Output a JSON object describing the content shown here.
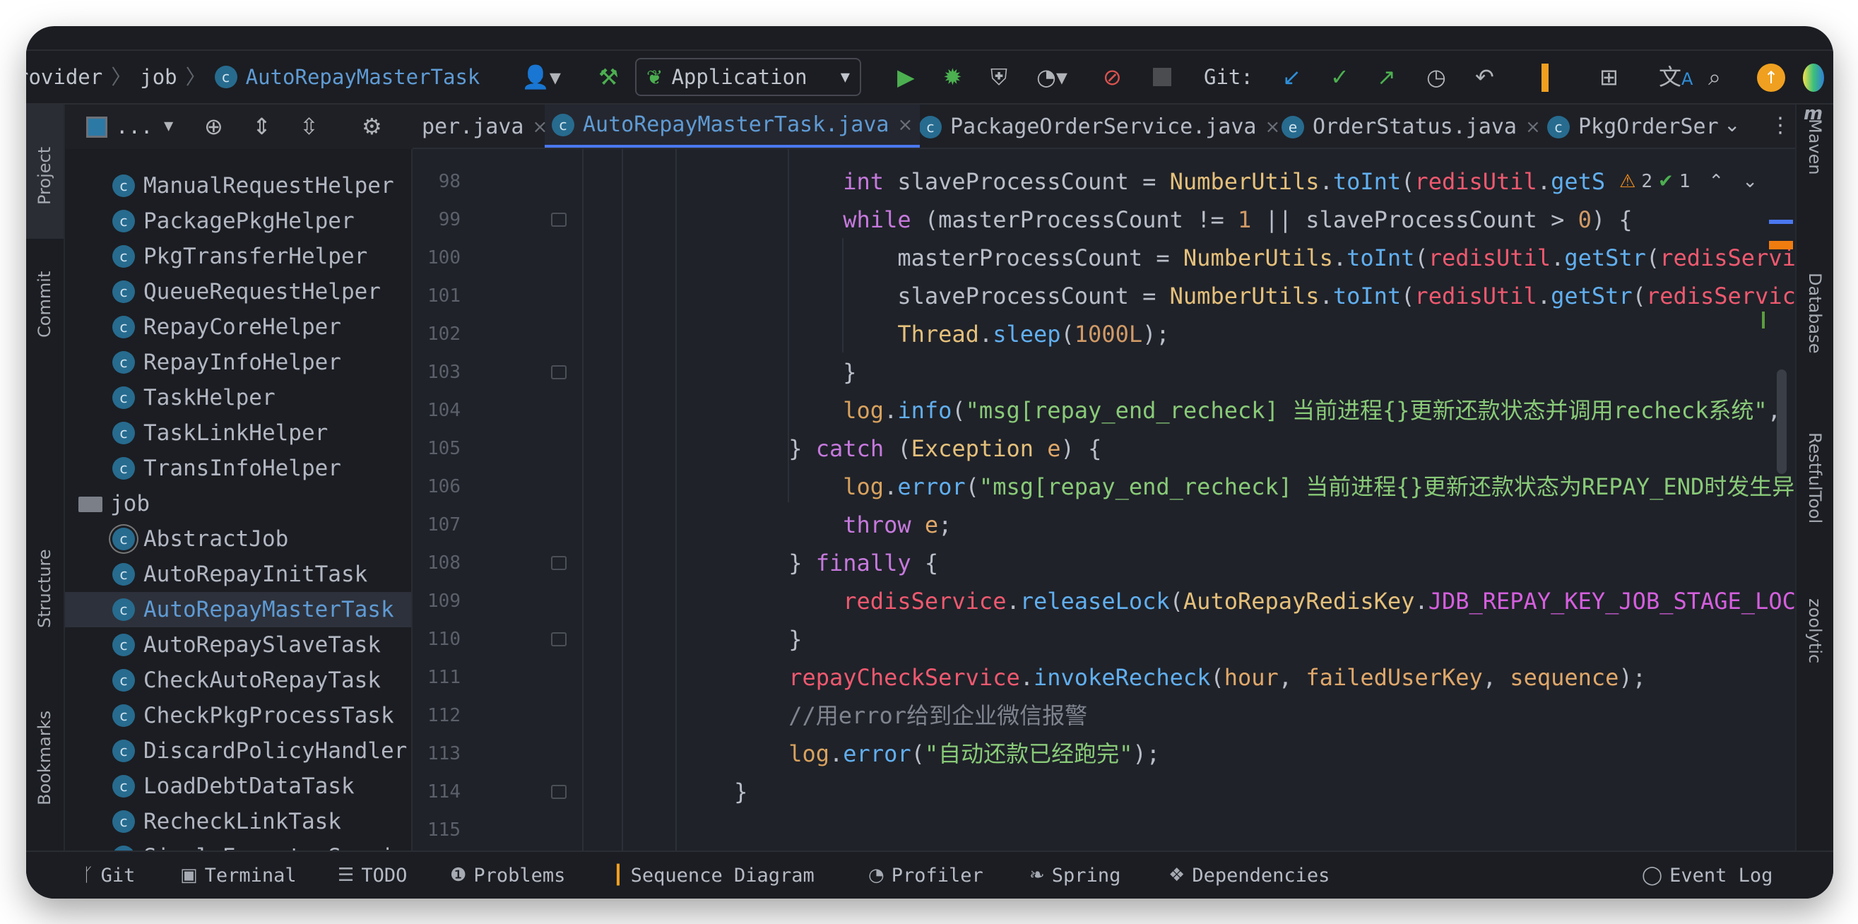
{
  "toolbar": {
    "breadcrumb": [
      "rovider",
      "job",
      "AutoRepayMasterTask"
    ],
    "run_config": "Application",
    "git_label": "Git:"
  },
  "left_strip": [
    "Project",
    "Commit",
    "Structure",
    "Bookmarks"
  ],
  "right_strip": [
    "Maven",
    "Database",
    "RestfulTool",
    "zoolytic"
  ],
  "project_panel": {
    "view_label": "...",
    "tree": [
      {
        "label": "ManualRequestHelper",
        "type": "class"
      },
      {
        "label": "PackagePkgHelper",
        "type": "class"
      },
      {
        "label": "PkgTransferHelper",
        "type": "class"
      },
      {
        "label": "QueueRequestHelper",
        "type": "class"
      },
      {
        "label": "RepayCoreHelper",
        "type": "class"
      },
      {
        "label": "RepayInfoHelper",
        "type": "class"
      },
      {
        "label": "TaskHelper",
        "type": "class"
      },
      {
        "label": "TaskLinkHelper",
        "type": "class"
      },
      {
        "label": "TransInfoHelper",
        "type": "class"
      },
      {
        "label": "job",
        "type": "folder"
      },
      {
        "label": "AbstractJob",
        "type": "abstract"
      },
      {
        "label": "AutoRepayInitTask",
        "type": "class"
      },
      {
        "label": "AutoRepayMasterTask",
        "type": "class",
        "selected": true
      },
      {
        "label": "AutoRepaySlaveTask",
        "type": "class"
      },
      {
        "label": "CheckAutoRepayTask",
        "type": "class"
      },
      {
        "label": "CheckPkgProcessTask",
        "type": "class"
      },
      {
        "label": "DiscardPolicyHandler",
        "type": "class"
      },
      {
        "label": "LoadDebtDataTask",
        "type": "class"
      },
      {
        "label": "RecheckLinkTask",
        "type": "class"
      },
      {
        "label": "SimpleExecutorService",
        "type": "class"
      }
    ]
  },
  "tabs": [
    {
      "label": "per.java",
      "icon": ""
    },
    {
      "label": "AutoRepayMasterTask.java",
      "icon": "C",
      "active": true
    },
    {
      "label": "PackageOrderService.java",
      "icon": "C"
    },
    {
      "label": "OrderStatus.java",
      "icon": "E"
    },
    {
      "label": "PkgOrderSer",
      "icon": "C"
    }
  ],
  "inspections": {
    "warnings": "2",
    "ok": "1"
  },
  "code": [
    {
      "n": "98",
      "indent": 20,
      "t": [
        [
          "int",
          "kw"
        ],
        [
          " slaveProcessCount = ",
          "df"
        ],
        [
          "NumberUtils",
          "cls"
        ],
        [
          ".",
          "df"
        ],
        [
          "toInt",
          "fn"
        ],
        [
          "(",
          "df"
        ],
        [
          "redisUtil",
          "fld"
        ],
        [
          ".",
          "df"
        ],
        [
          "getS",
          "fn"
        ]
      ]
    },
    {
      "n": "99",
      "indent": 20,
      "t": [
        [
          "while",
          "kw"
        ],
        [
          " (masterProcessCount != ",
          "df"
        ],
        [
          "1",
          "num"
        ],
        [
          " || slaveProcessCount > ",
          "df"
        ],
        [
          "0",
          "num"
        ],
        [
          ") {",
          "df"
        ]
      ]
    },
    {
      "n": "100",
      "indent": 24,
      "t": [
        [
          "masterProcessCount = ",
          "df"
        ],
        [
          "NumberUtils",
          "cls"
        ],
        [
          ".",
          "df"
        ],
        [
          "toInt",
          "fn"
        ],
        [
          "(",
          "df"
        ],
        [
          "redisUtil",
          "fld"
        ],
        [
          ".",
          "df"
        ],
        [
          "getStr",
          "fn"
        ],
        [
          "(",
          "df"
        ],
        [
          "redisService",
          "fld"
        ]
      ]
    },
    {
      "n": "101",
      "indent": 24,
      "t": [
        [
          "slaveProcessCount = ",
          "df"
        ],
        [
          "NumberUtils",
          "cls"
        ],
        [
          ".",
          "df"
        ],
        [
          "toInt",
          "fn"
        ],
        [
          "(",
          "df"
        ],
        [
          "redisUtil",
          "fld"
        ],
        [
          ".",
          "df"
        ],
        [
          "getStr",
          "fn"
        ],
        [
          "(",
          "df"
        ],
        [
          "redisService",
          "fld"
        ]
      ]
    },
    {
      "n": "102",
      "indent": 24,
      "t": [
        [
          "Thread",
          "cls"
        ],
        [
          ".",
          "df"
        ],
        [
          "sleep",
          "fn"
        ],
        [
          "(",
          "df"
        ],
        [
          "1000L",
          "num"
        ],
        [
          ");",
          "df"
        ]
      ]
    },
    {
      "n": "103",
      "indent": 20,
      "t": [
        [
          "}",
          "df"
        ]
      ]
    },
    {
      "n": "104",
      "indent": 20,
      "t": [
        [
          "log",
          "lg"
        ],
        [
          ".",
          "df"
        ],
        [
          "info",
          "fn"
        ],
        [
          "(",
          "df"
        ],
        [
          "\"msg[repay_end_recheck] 当前进程{}更新还款状态并调用recheck系统\"",
          "str"
        ],
        [
          ", ",
          "df"
        ]
      ]
    },
    {
      "n": "105",
      "indent": 16,
      "t": [
        [
          "} ",
          "df"
        ],
        [
          "catch",
          "kw"
        ],
        [
          " (",
          "df"
        ],
        [
          "Exception",
          "cls"
        ],
        [
          " ",
          "df"
        ],
        [
          "e",
          "loc"
        ],
        [
          ") {",
          "df"
        ]
      ]
    },
    {
      "n": "106",
      "indent": 20,
      "t": [
        [
          "log",
          "lg"
        ],
        [
          ".",
          "df"
        ],
        [
          "error",
          "fn"
        ],
        [
          "(",
          "df"
        ],
        [
          "\"msg[repay_end_recheck] 当前进程{}更新还款状态为REPAY_END时发生异常\"",
          "str"
        ]
      ]
    },
    {
      "n": "107",
      "indent": 20,
      "t": [
        [
          "throw",
          "kw"
        ],
        [
          " ",
          "df"
        ],
        [
          "e",
          "loc"
        ],
        [
          ";",
          "df"
        ]
      ]
    },
    {
      "n": "108",
      "indent": 16,
      "t": [
        [
          "} ",
          "df"
        ],
        [
          "finally",
          "kw"
        ],
        [
          " {",
          "df"
        ]
      ]
    },
    {
      "n": "109",
      "indent": 20,
      "t": [
        [
          "redisService",
          "fld"
        ],
        [
          ".",
          "df"
        ],
        [
          "releaseLock",
          "fn"
        ],
        [
          "(",
          "df"
        ],
        [
          "AutoRepayRedisKey",
          "cls"
        ],
        [
          ".",
          "df"
        ],
        [
          "JDB_REPAY_KEY_JOB_STAGE_LOCK",
          "cst"
        ]
      ]
    },
    {
      "n": "110",
      "indent": 16,
      "t": [
        [
          "}",
          "df"
        ]
      ]
    },
    {
      "n": "111",
      "indent": 16,
      "t": [
        [
          "repayCheckService",
          "fld"
        ],
        [
          ".",
          "df"
        ],
        [
          "invokeRecheck",
          "fn"
        ],
        [
          "(",
          "df"
        ],
        [
          "hour",
          "loc"
        ],
        [
          ", ",
          "df"
        ],
        [
          "failedUserKey",
          "loc"
        ],
        [
          ", ",
          "df"
        ],
        [
          "sequence",
          "loc"
        ],
        [
          ");",
          "df"
        ]
      ]
    },
    {
      "n": "112",
      "indent": 16,
      "t": [
        [
          "//用error给到企业微信报警",
          "cm"
        ]
      ]
    },
    {
      "n": "113",
      "indent": 16,
      "t": [
        [
          "log",
          "lg"
        ],
        [
          ".",
          "df"
        ],
        [
          "error",
          "fn"
        ],
        [
          "(",
          "df"
        ],
        [
          "\"自动还款已经跑完\"",
          "str"
        ],
        [
          ");",
          "df"
        ]
      ]
    },
    {
      "n": "114",
      "indent": 12,
      "t": [
        [
          "}",
          "df"
        ]
      ]
    },
    {
      "n": "115",
      "indent": 0,
      "t": []
    }
  ],
  "bottom_bar": {
    "items": [
      "Git",
      "Terminal",
      "TODO",
      "Problems",
      "Sequence Diagram",
      "Profiler",
      "Spring",
      "Dependencies"
    ],
    "event_log": "Event Log"
  },
  "colors": {
    "accent": "#4a78f0",
    "class_icon": "#276b8f",
    "update_badge": "#f0a020",
    "run_green": "#4caf50"
  }
}
